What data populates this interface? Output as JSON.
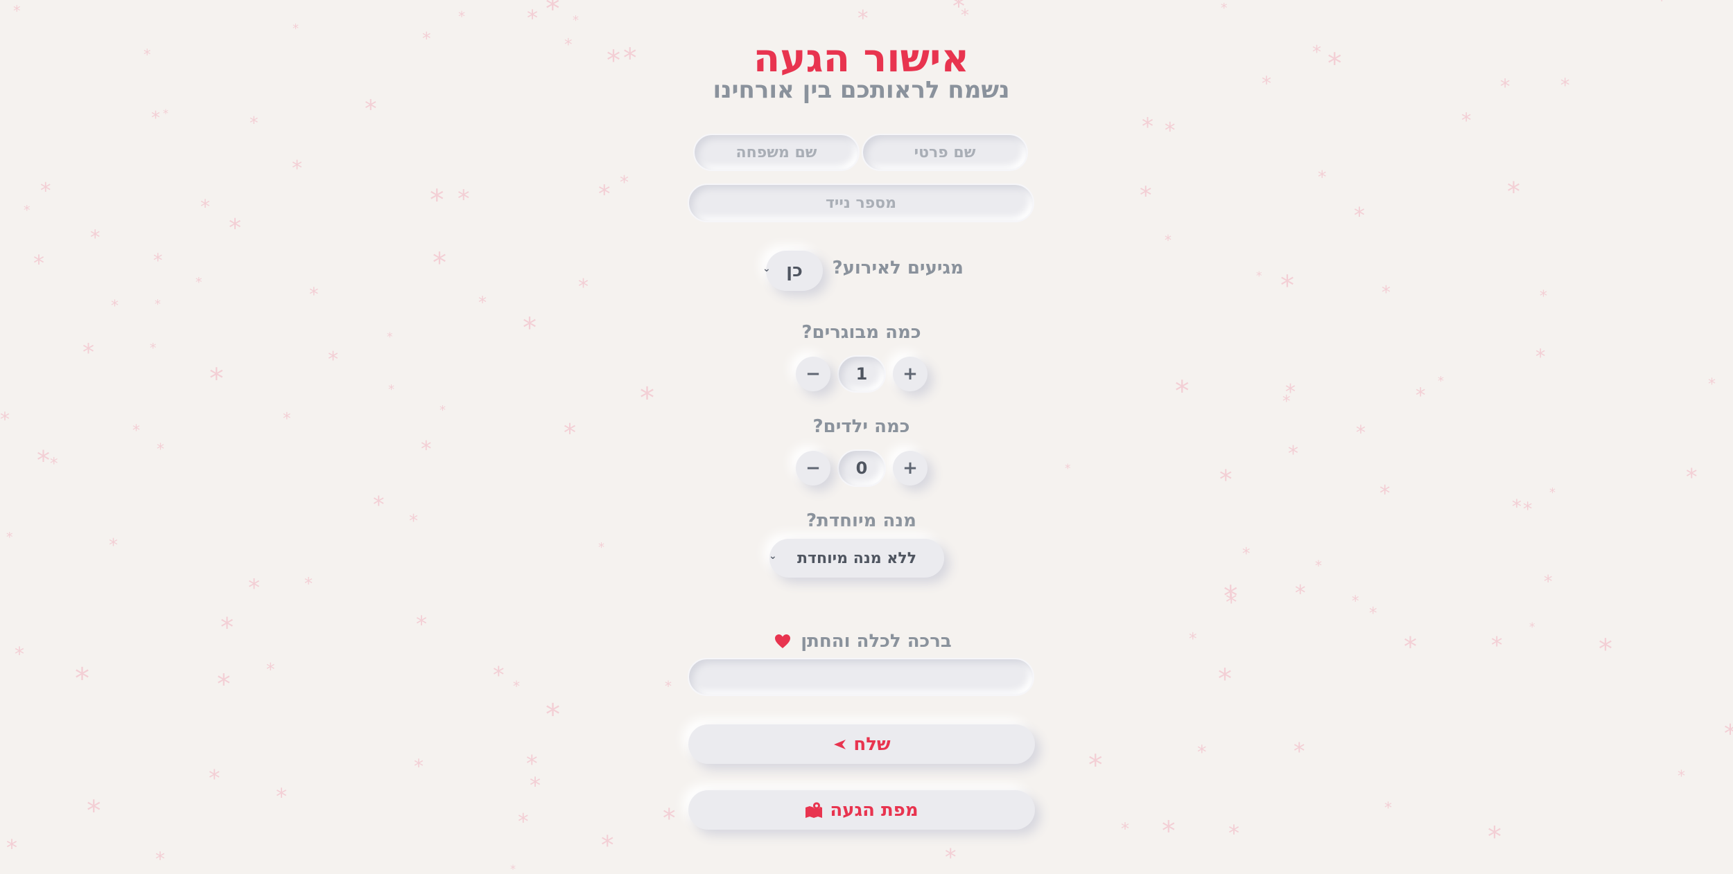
{
  "header": {
    "title": "אישור הגעה",
    "subtitle": "נשמח לראותכם בין אורחינו"
  },
  "form": {
    "first_name_placeholder": "שם פרטי",
    "last_name_placeholder": "שם משפחה",
    "phone_placeholder": "מספר נייד",
    "attending": {
      "label": "מגיעים לאירוע?",
      "value": "כן"
    },
    "adults": {
      "label": "כמה מבוגרים?",
      "value": "1",
      "plus": "+",
      "minus": "−"
    },
    "children": {
      "label": "כמה ילדים?",
      "value": "0",
      "plus": "+",
      "minus": "−"
    },
    "meal": {
      "label": "מנה מיוחדת?",
      "value": "ללא מנה מיוחדת"
    },
    "blessing": {
      "label": "ברכה לכלה והחתן",
      "value": ""
    },
    "submit_label": "שלח",
    "map_label": "מפת הגעה"
  },
  "colors": {
    "accent": "#e8344f",
    "text": "#8a929c",
    "background": "#f5f2ef",
    "surface": "#ebebef"
  },
  "icons": {
    "send": "send-icon",
    "map": "map-icon",
    "heart": "heart-icon",
    "chevron": "chevron-down-icon"
  }
}
